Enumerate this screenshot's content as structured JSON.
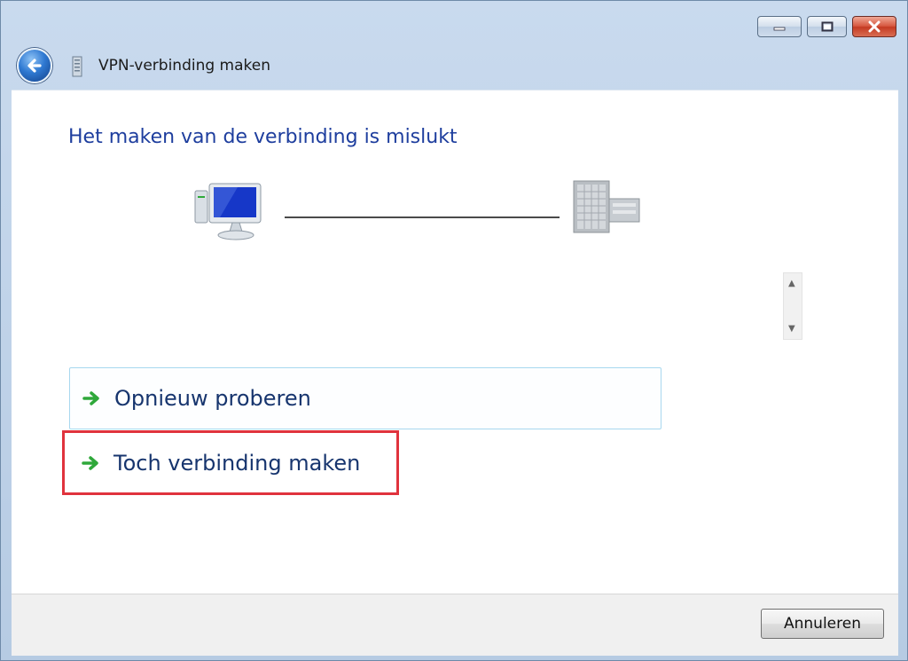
{
  "window": {
    "title": "VPN-verbinding maken",
    "controls": {
      "minimize_icon": "minimize-icon",
      "maximize_icon": "maximize-icon",
      "close_icon": "close-icon"
    }
  },
  "main": {
    "heading": "Het maken van de verbinding is mislukt",
    "diagram": {
      "left_icon": "computer-icon",
      "right_icon": "server-icon"
    },
    "commands": [
      {
        "label": "Opnieuw proberen",
        "icon": "green-arrow-icon"
      },
      {
        "label": "Toch verbinding maken",
        "icon": "green-arrow-icon"
      }
    ]
  },
  "footer": {
    "cancel_label": "Annuleren"
  },
  "colors": {
    "heading": "#1e3e9e",
    "command_text": "#17356e",
    "highlight_border": "#e0333d",
    "arrow": "#2fa83a"
  }
}
